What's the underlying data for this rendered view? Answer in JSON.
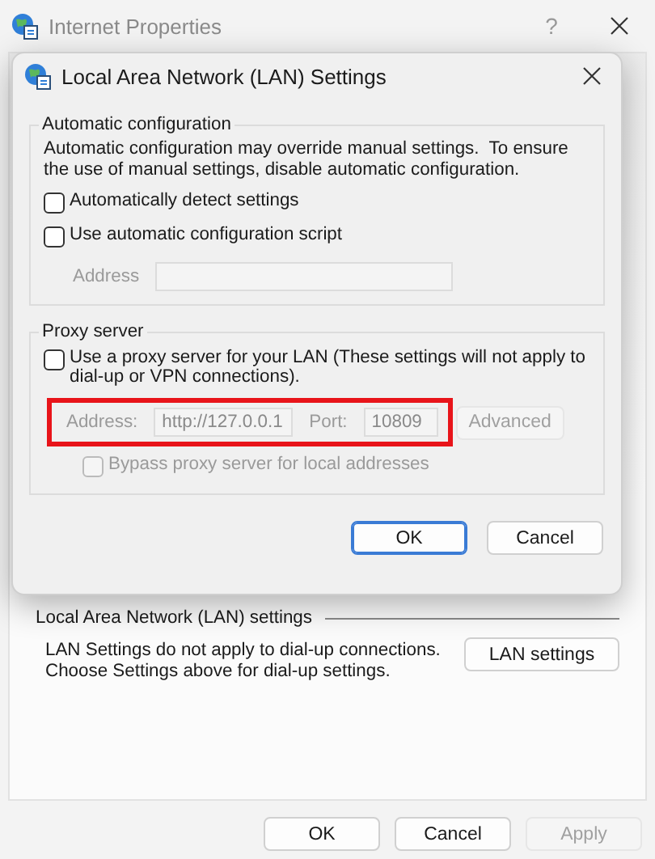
{
  "background_window": {
    "title": "Internet Properties",
    "help": "?",
    "lan_group": {
      "title": "Local Area Network (LAN) settings",
      "note": "LAN Settings do not apply to dial-up connections.\nChoose Settings above for dial-up settings.",
      "button": "LAN settings"
    },
    "buttons": [
      {
        "label": "OK",
        "disabled": false
      },
      {
        "label": "Cancel",
        "disabled": false
      },
      {
        "label": "Apply",
        "disabled": true
      }
    ]
  },
  "dialog": {
    "title": "Local Area Network (LAN) Settings",
    "auto_config": {
      "title": "Automatic configuration",
      "description": "Automatic configuration may override manual settings.  To ensure the use of manual settings, disable automatic configuration.",
      "options": [
        {
          "label": "Automatically detect settings",
          "checked": false,
          "disabled": false
        },
        {
          "label": "Use automatic configuration script",
          "checked": false,
          "disabled": false
        }
      ],
      "address": {
        "label": "Address",
        "disabled": true
      }
    },
    "proxy": {
      "title": "Proxy server",
      "option": {
        "label": "Use a proxy server for your LAN (These settings will not apply to dial-up or VPN connections).",
        "checked": false,
        "disabled": false
      },
      "highlighted": true,
      "address": {
        "label": "Address:",
        "value": "http://127.0.0.1",
        "disabled": true
      },
      "port": {
        "label": "Port:",
        "value": "10809",
        "disabled": true
      },
      "advanced": {
        "label": "Advanced",
        "disabled": true
      },
      "bypass": {
        "label": "Bypass proxy server for local addresses",
        "checked": false,
        "disabled": true
      }
    },
    "buttons": [
      {
        "label": "OK",
        "default": true
      },
      {
        "label": "Cancel",
        "default": false
      }
    ]
  }
}
